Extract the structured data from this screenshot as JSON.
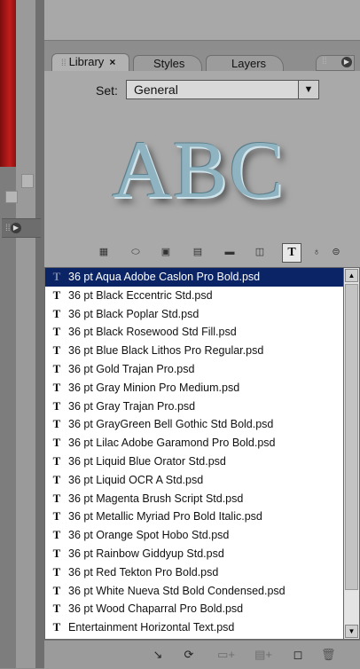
{
  "tabs": [
    {
      "label": "Library",
      "active": true
    },
    {
      "label": "Styles",
      "active": false
    },
    {
      "label": "Layers",
      "active": false
    }
  ],
  "tab_close_glyph": "×",
  "set": {
    "label": "Set:",
    "value": "General"
  },
  "preview": {
    "text": "ABC"
  },
  "filter_icons": [
    "grid-icon",
    "pill-icon",
    "photo-icon",
    "texture-icon",
    "shape-icon",
    "text-T-icon",
    "tool-icon",
    "badge-icon"
  ],
  "list": {
    "items": [
      "36 pt Aqua Adobe Caslon Pro Bold.psd",
      "36 pt Black Eccentric Std.psd",
      "36 pt Black Poplar Std.psd",
      "36 pt Black Rosewood Std Fill.psd",
      "36 pt Blue Black Lithos Pro Regular.psd",
      "36 pt Gold Trajan Pro.psd",
      "36 pt Gray Minion Pro Medium.psd",
      "36 pt Gray Trajan Pro.psd",
      "36 pt GrayGreen Bell Gothic Std Bold.psd",
      "36 pt Lilac Adobe Garamond Pro Bold.psd",
      "36 pt Liquid Blue Orator Std.psd",
      "36 pt Liquid OCR A Std.psd",
      "36 pt Magenta Brush Script Std.psd",
      "36 pt Metallic Myriad Pro Bold Italic.psd",
      "36 pt Orange Spot Hobo Std.psd",
      "36 pt Rainbow Giddyup Std.psd",
      "36 pt Red Tekton Pro Bold.psd",
      "36 pt White Nueva Std Bold Condensed.psd",
      "36 pt Wood Chaparral Pro Bold.psd",
      "Entertainment Horizontal Text.psd"
    ],
    "selected_index": 0,
    "item_icon": "T"
  },
  "colors": {
    "selection": "#0a2466",
    "preview_text": "#8fb3c1",
    "red_panel": "#c11d1d"
  }
}
